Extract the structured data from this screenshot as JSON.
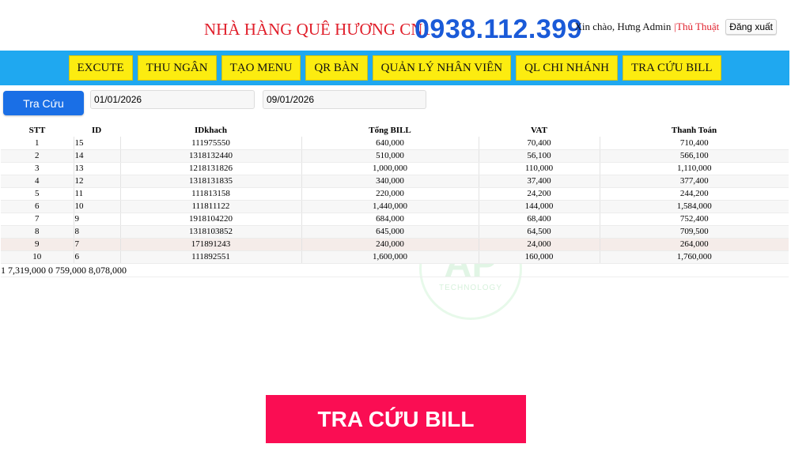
{
  "header": {
    "title": "NHÀ HÀNG QUÊ HƯƠNG CN1",
    "phone": "0938.112.399",
    "greeting": "Xin chào, Hưng Admin",
    "separator": "|",
    "tricks_link": "Thủ Thuật",
    "logout_label": "Đăng xuất"
  },
  "nav": {
    "items": [
      {
        "label": "EXCUTE"
      },
      {
        "label": "THU NGÂN"
      },
      {
        "label": "TẠO MENU"
      },
      {
        "label": "QR BÀN"
      },
      {
        "label": "QUẢN LÝ NHÂN VIÊN"
      },
      {
        "label": "QL CHI NHÁNH"
      },
      {
        "label": "TRA CỨU BILL"
      }
    ]
  },
  "search": {
    "button_label": "Tra Cứu",
    "date_from": "01/01/2026",
    "date_to": "09/01/2026"
  },
  "table": {
    "headers": [
      "STT",
      "ID",
      "IDkhach",
      "Tổng BILL",
      "VAT",
      "Thanh Toán"
    ],
    "rows": [
      [
        "1",
        "15",
        "111975550",
        "640,000",
        "70,400",
        "710,400"
      ],
      [
        "2",
        "14",
        "1318132440",
        "510,000",
        "56,100",
        "566,100"
      ],
      [
        "3",
        "13",
        "1218131826",
        "1,000,000",
        "110,000",
        "1,110,000"
      ],
      [
        "4",
        "12",
        "1318131835",
        "340,000",
        "37,400",
        "377,400"
      ],
      [
        "5",
        "11",
        "111813158",
        "220,000",
        "24,200",
        "244,200"
      ],
      [
        "6",
        "10",
        "111811122",
        "1,440,000",
        "144,000",
        "1,584,000"
      ],
      [
        "7",
        "9",
        "1918104220",
        "684,000",
        "68,400",
        "752,400"
      ],
      [
        "8",
        "8",
        "1318103852",
        "645,000",
        "64,500",
        "709,500"
      ],
      [
        "9",
        "7",
        "171891243",
        "240,000",
        "24,000",
        "264,000"
      ],
      [
        "10",
        "6",
        "111892551",
        "1,600,000",
        "160,000",
        "1,760,000"
      ]
    ],
    "summary": "1 7,319,000 0 759,000 8,078,000"
  },
  "watermark": {
    "letters": "AP",
    "sub": "TECHNOLOGY"
  },
  "banner": {
    "label": "TRA CỨU BILL"
  },
  "colors": {
    "title_red": "#e01e2a",
    "phone_blue": "#1a5ad8",
    "navbar_blue": "#1fa8f0",
    "nav_yellow": "#fcec10",
    "search_blue": "#1a6fe6",
    "banner_pink": "#fa0d53"
  }
}
